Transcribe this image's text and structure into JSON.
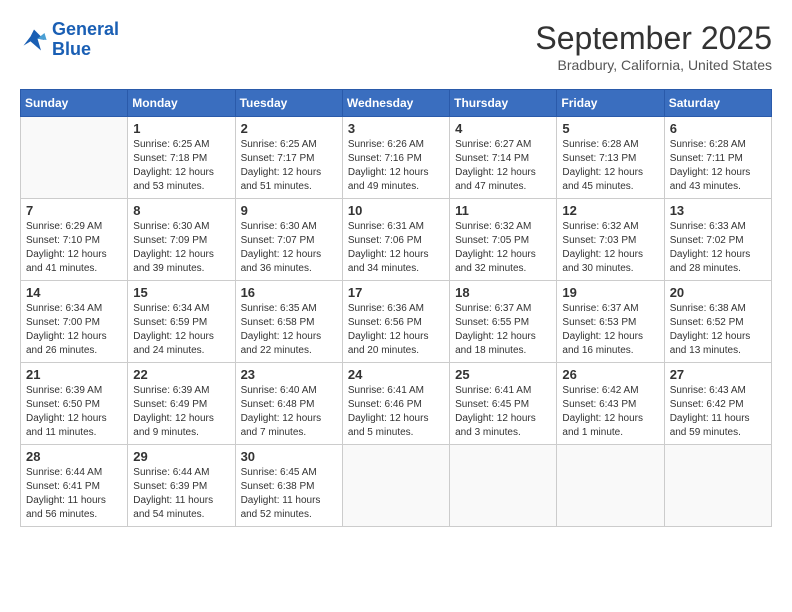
{
  "logo": {
    "line1": "General",
    "line2": "Blue"
  },
  "title": "September 2025",
  "location": "Bradbury, California, United States",
  "days_of_week": [
    "Sunday",
    "Monday",
    "Tuesday",
    "Wednesday",
    "Thursday",
    "Friday",
    "Saturday"
  ],
  "weeks": [
    [
      {
        "day": "",
        "info": ""
      },
      {
        "day": "1",
        "info": "Sunrise: 6:25 AM\nSunset: 7:18 PM\nDaylight: 12 hours\nand 53 minutes."
      },
      {
        "day": "2",
        "info": "Sunrise: 6:25 AM\nSunset: 7:17 PM\nDaylight: 12 hours\nand 51 minutes."
      },
      {
        "day": "3",
        "info": "Sunrise: 6:26 AM\nSunset: 7:16 PM\nDaylight: 12 hours\nand 49 minutes."
      },
      {
        "day": "4",
        "info": "Sunrise: 6:27 AM\nSunset: 7:14 PM\nDaylight: 12 hours\nand 47 minutes."
      },
      {
        "day": "5",
        "info": "Sunrise: 6:28 AM\nSunset: 7:13 PM\nDaylight: 12 hours\nand 45 minutes."
      },
      {
        "day": "6",
        "info": "Sunrise: 6:28 AM\nSunset: 7:11 PM\nDaylight: 12 hours\nand 43 minutes."
      }
    ],
    [
      {
        "day": "7",
        "info": "Sunrise: 6:29 AM\nSunset: 7:10 PM\nDaylight: 12 hours\nand 41 minutes."
      },
      {
        "day": "8",
        "info": "Sunrise: 6:30 AM\nSunset: 7:09 PM\nDaylight: 12 hours\nand 39 minutes."
      },
      {
        "day": "9",
        "info": "Sunrise: 6:30 AM\nSunset: 7:07 PM\nDaylight: 12 hours\nand 36 minutes."
      },
      {
        "day": "10",
        "info": "Sunrise: 6:31 AM\nSunset: 7:06 PM\nDaylight: 12 hours\nand 34 minutes."
      },
      {
        "day": "11",
        "info": "Sunrise: 6:32 AM\nSunset: 7:05 PM\nDaylight: 12 hours\nand 32 minutes."
      },
      {
        "day": "12",
        "info": "Sunrise: 6:32 AM\nSunset: 7:03 PM\nDaylight: 12 hours\nand 30 minutes."
      },
      {
        "day": "13",
        "info": "Sunrise: 6:33 AM\nSunset: 7:02 PM\nDaylight: 12 hours\nand 28 minutes."
      }
    ],
    [
      {
        "day": "14",
        "info": "Sunrise: 6:34 AM\nSunset: 7:00 PM\nDaylight: 12 hours\nand 26 minutes."
      },
      {
        "day": "15",
        "info": "Sunrise: 6:34 AM\nSunset: 6:59 PM\nDaylight: 12 hours\nand 24 minutes."
      },
      {
        "day": "16",
        "info": "Sunrise: 6:35 AM\nSunset: 6:58 PM\nDaylight: 12 hours\nand 22 minutes."
      },
      {
        "day": "17",
        "info": "Sunrise: 6:36 AM\nSunset: 6:56 PM\nDaylight: 12 hours\nand 20 minutes."
      },
      {
        "day": "18",
        "info": "Sunrise: 6:37 AM\nSunset: 6:55 PM\nDaylight: 12 hours\nand 18 minutes."
      },
      {
        "day": "19",
        "info": "Sunrise: 6:37 AM\nSunset: 6:53 PM\nDaylight: 12 hours\nand 16 minutes."
      },
      {
        "day": "20",
        "info": "Sunrise: 6:38 AM\nSunset: 6:52 PM\nDaylight: 12 hours\nand 13 minutes."
      }
    ],
    [
      {
        "day": "21",
        "info": "Sunrise: 6:39 AM\nSunset: 6:50 PM\nDaylight: 12 hours\nand 11 minutes."
      },
      {
        "day": "22",
        "info": "Sunrise: 6:39 AM\nSunset: 6:49 PM\nDaylight: 12 hours\nand 9 minutes."
      },
      {
        "day": "23",
        "info": "Sunrise: 6:40 AM\nSunset: 6:48 PM\nDaylight: 12 hours\nand 7 minutes."
      },
      {
        "day": "24",
        "info": "Sunrise: 6:41 AM\nSunset: 6:46 PM\nDaylight: 12 hours\nand 5 minutes."
      },
      {
        "day": "25",
        "info": "Sunrise: 6:41 AM\nSunset: 6:45 PM\nDaylight: 12 hours\nand 3 minutes."
      },
      {
        "day": "26",
        "info": "Sunrise: 6:42 AM\nSunset: 6:43 PM\nDaylight: 12 hours\nand 1 minute."
      },
      {
        "day": "27",
        "info": "Sunrise: 6:43 AM\nSunset: 6:42 PM\nDaylight: 11 hours\nand 59 minutes."
      }
    ],
    [
      {
        "day": "28",
        "info": "Sunrise: 6:44 AM\nSunset: 6:41 PM\nDaylight: 11 hours\nand 56 minutes."
      },
      {
        "day": "29",
        "info": "Sunrise: 6:44 AM\nSunset: 6:39 PM\nDaylight: 11 hours\nand 54 minutes."
      },
      {
        "day": "30",
        "info": "Sunrise: 6:45 AM\nSunset: 6:38 PM\nDaylight: 11 hours\nand 52 minutes."
      },
      {
        "day": "",
        "info": ""
      },
      {
        "day": "",
        "info": ""
      },
      {
        "day": "",
        "info": ""
      },
      {
        "day": "",
        "info": ""
      }
    ]
  ]
}
